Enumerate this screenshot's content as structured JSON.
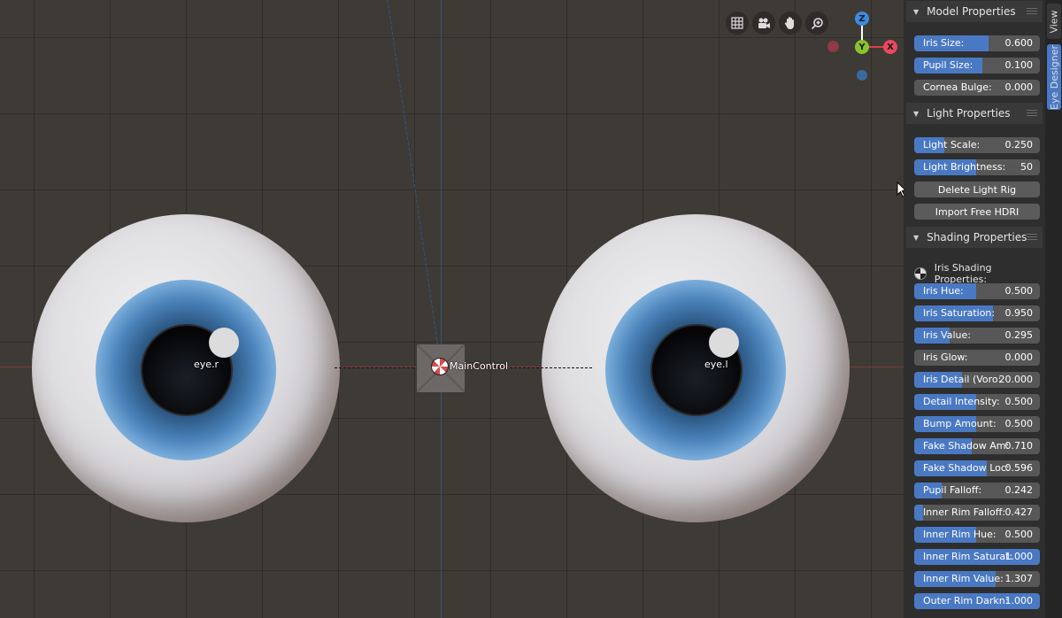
{
  "viewport": {
    "objects": {
      "eye_right": "eye.r",
      "eye_left": "eye.l",
      "control": "MainControl"
    },
    "nav_icons": [
      "grid-icon",
      "camera-icon",
      "hand-icon",
      "zoom-icon"
    ],
    "gizmo": {
      "z": "Z",
      "y": "Y",
      "x": "X"
    }
  },
  "sidebar": {
    "model_properties": {
      "title": "Model Properties",
      "fields": [
        {
          "label": "Iris Size:",
          "value": "0.600",
          "fill": 0.59
        },
        {
          "label": "Pupil Size:",
          "value": "0.100",
          "fill": 0.54
        },
        {
          "label": "Cornea Bulge:",
          "value": "0.000",
          "fill": 0.0
        }
      ]
    },
    "light_properties": {
      "title": "Light Properties",
      "fields": [
        {
          "label": "Light Scale:",
          "value": "0.250",
          "fill": 0.24
        },
        {
          "label": "Light Brightness:",
          "value": "50",
          "fill": 0.49
        }
      ],
      "buttons": [
        "Delete Light Rig",
        "Import Free HDRI"
      ]
    },
    "shading_properties": {
      "title": "Shading Properties",
      "subheading": "Iris Shading Properties:",
      "fields": [
        {
          "label": "Iris Hue:",
          "value": "0.500",
          "fill": 0.49
        },
        {
          "label": "Iris Saturation:",
          "value": "0.950",
          "fill": 0.63
        },
        {
          "label": "Iris Value:",
          "value": "0.295",
          "fill": 0.28
        },
        {
          "label": "Iris Glow:",
          "value": "0.000",
          "fill": 0.0
        },
        {
          "label": "Iris Detail (Voro:",
          "value": "20.000",
          "fill": 0.38
        },
        {
          "label": "Detail Intensity:",
          "value": "0.500",
          "fill": 0.49
        },
        {
          "label": "Bump Amount:",
          "value": "0.500",
          "fill": 0.49
        },
        {
          "label": "Fake Shadow Am:",
          "value": "0.710",
          "fill": 0.46
        },
        {
          "label": "Fake Shadow Loc:",
          "value": "0.596",
          "fill": 0.58
        },
        {
          "label": "Pupil Falloff:",
          "value": "0.242",
          "fill": 0.22
        },
        {
          "label": "Inner Rim Falloff:",
          "value": "0.427",
          "fill": 0.07
        },
        {
          "label": "Inner Rim Hue:",
          "value": "0.500",
          "fill": 0.49
        },
        {
          "label": "Inner Rim Saturat:",
          "value": "1.000",
          "fill": 1.0
        },
        {
          "label": "Inner Rim Value:",
          "value": "1.307",
          "fill": 0.65
        },
        {
          "label": "Outer Rim Darkn:",
          "value": "1.000",
          "fill": 1.0
        }
      ]
    }
  },
  "tabs": [
    "View",
    "Eye Designer"
  ],
  "colors": {
    "accent": "#4a79c3",
    "panel": "#2e2e2e",
    "viewport": "#3e3a36"
  }
}
